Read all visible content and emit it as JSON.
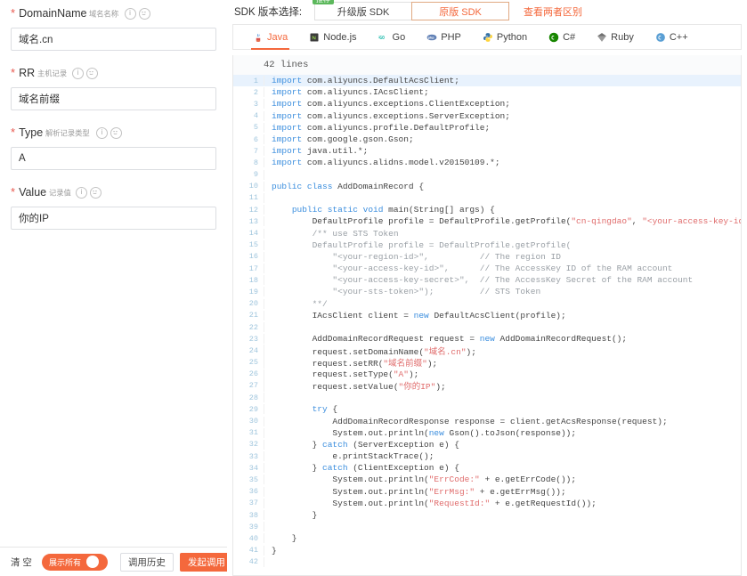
{
  "form": {
    "fields": [
      {
        "name": "DomainName",
        "cn": "域名名称",
        "value": "域名.cn",
        "required": true
      },
      {
        "name": "RR",
        "cn": "主机记录",
        "value": "域名前缀",
        "required": true
      },
      {
        "name": "Type",
        "cn": "解析记录类型",
        "value": "A",
        "required": true
      },
      {
        "name": "Value",
        "cn": "记录值",
        "value": "你的IP",
        "required": true
      }
    ]
  },
  "footer": {
    "clear_label": "清 空",
    "show_all_label": "展示所有",
    "history_label": "调用历史",
    "invoke_label": "发起调用"
  },
  "sdk": {
    "label": "SDK 版本选择:",
    "badge": "推荐",
    "tabs": [
      {
        "label": "升级版 SDK",
        "active": false
      },
      {
        "label": "原版 SDK",
        "active": true
      }
    ],
    "diff_link": "查看两者区别"
  },
  "languages": [
    {
      "label": "Java",
      "icon": "java-icon",
      "active": true
    },
    {
      "label": "Node.js",
      "icon": "nodejs-icon",
      "active": false
    },
    {
      "label": "Go",
      "icon": "go-icon",
      "active": false
    },
    {
      "label": "PHP",
      "icon": "php-icon",
      "active": false
    },
    {
      "label": "Python",
      "icon": "python-icon",
      "active": false
    },
    {
      "label": "C#",
      "icon": "csharp-icon",
      "active": false
    },
    {
      "label": "Ruby",
      "icon": "ruby-icon",
      "active": false
    },
    {
      "label": "C++",
      "icon": "cpp-icon",
      "active": false
    }
  ],
  "code": {
    "line_count_label": "42 lines",
    "lines": [
      {
        "n": 1,
        "hl": true,
        "t": "<span class=\"kw\">import</span> com.aliyuncs.DefaultAcsClient;"
      },
      {
        "n": 2,
        "t": "<span class=\"kw\">import</span> com.aliyuncs.IAcsClient;"
      },
      {
        "n": 3,
        "t": "<span class=\"kw\">import</span> com.aliyuncs.exceptions.ClientException;"
      },
      {
        "n": 4,
        "t": "<span class=\"kw\">import</span> com.aliyuncs.exceptions.ServerException;"
      },
      {
        "n": 5,
        "t": "<span class=\"kw\">import</span> com.aliyuncs.profile.DefaultProfile;"
      },
      {
        "n": 6,
        "t": "<span class=\"kw\">import</span> com.google.gson.Gson;"
      },
      {
        "n": 7,
        "t": "<span class=\"kw\">import</span> java.util.*;"
      },
      {
        "n": 8,
        "t": "<span class=\"kw\">import</span> com.aliyuncs.alidns.model.v20150109.*;"
      },
      {
        "n": 9,
        "t": ""
      },
      {
        "n": 10,
        "t": "<span class=\"kw\">public class</span> AddDomainRecord {"
      },
      {
        "n": 11,
        "t": ""
      },
      {
        "n": 12,
        "t": "    <span class=\"kw\">public static void</span> main(String[] args) {"
      },
      {
        "n": 13,
        "t": "        DefaultProfile profile = DefaultProfile.getProfile(<span class=\"str\">\"cn-qingdao\"</span>, <span class=\"str\">\"&lt;your-access-key-id&gt;\"</span>, <span class=\"str\">\"&lt;your-access-key-secret&gt;\"</span>);"
      },
      {
        "n": 14,
        "t": "        <span class=\"cmt\">/** use STS Token</span>"
      },
      {
        "n": 15,
        "t": "        <span class=\"cmt\">DefaultProfile profile = DefaultProfile.getProfile(</span>"
      },
      {
        "n": 16,
        "t": "            <span class=\"cmt\">\"&lt;your-region-id&gt;\",          // The region ID</span>"
      },
      {
        "n": 17,
        "t": "            <span class=\"cmt\">\"&lt;your-access-key-id&gt;\",      // The AccessKey ID of the RAM account</span>"
      },
      {
        "n": 18,
        "t": "            <span class=\"cmt\">\"&lt;your-access-key-secret&gt;\",  // The AccessKey Secret of the RAM account</span>"
      },
      {
        "n": 19,
        "t": "            <span class=\"cmt\">\"&lt;your-sts-token&gt;\");         // STS Token</span>"
      },
      {
        "n": 20,
        "t": "        <span class=\"cmt\">**/</span>"
      },
      {
        "n": 21,
        "t": "        IAcsClient client = <span class=\"kw\">new</span> DefaultAcsClient(profile);"
      },
      {
        "n": 22,
        "t": ""
      },
      {
        "n": 23,
        "t": "        AddDomainRecordRequest request = <span class=\"kw\">new</span> AddDomainRecordRequest();"
      },
      {
        "n": 24,
        "t": "        request.setDomainName(<span class=\"str\">\"域名.cn\"</span>);"
      },
      {
        "n": 25,
        "t": "        request.setRR(<span class=\"str\">\"域名前缀\"</span>);"
      },
      {
        "n": 26,
        "t": "        request.setType(<span class=\"str\">\"A\"</span>);"
      },
      {
        "n": 27,
        "t": "        request.setValue(<span class=\"str\">\"你的IP\"</span>);"
      },
      {
        "n": 28,
        "t": ""
      },
      {
        "n": 29,
        "t": "        <span class=\"kw\">try</span> {"
      },
      {
        "n": 30,
        "t": "            AddDomainRecordResponse response = client.getAcsResponse(request);"
      },
      {
        "n": 31,
        "t": "            System.out.println(<span class=\"kw\">new</span> Gson().toJson(response));"
      },
      {
        "n": 32,
        "t": "        } <span class=\"kw\">catch</span> (ServerException e) {"
      },
      {
        "n": 33,
        "t": "            e.printStackTrace();"
      },
      {
        "n": 34,
        "t": "        } <span class=\"kw\">catch</span> (ClientException e) {"
      },
      {
        "n": 35,
        "t": "            System.out.println(<span class=\"str\">\"ErrCode:\"</span> + e.getErrCode());"
      },
      {
        "n": 36,
        "t": "            System.out.println(<span class=\"str\">\"ErrMsg:\"</span> + e.getErrMsg());"
      },
      {
        "n": 37,
        "t": "            System.out.println(<span class=\"str\">\"RequestId:\"</span> + e.getRequestId());"
      },
      {
        "n": 38,
        "t": "        }"
      },
      {
        "n": 39,
        "t": ""
      },
      {
        "n": 40,
        "t": "    }"
      },
      {
        "n": 41,
        "t": "}"
      },
      {
        "n": 42,
        "t": ""
      }
    ]
  },
  "colors": {
    "accent": "#f4683c",
    "badge": "#5cb85c",
    "required": "#e8584f"
  }
}
